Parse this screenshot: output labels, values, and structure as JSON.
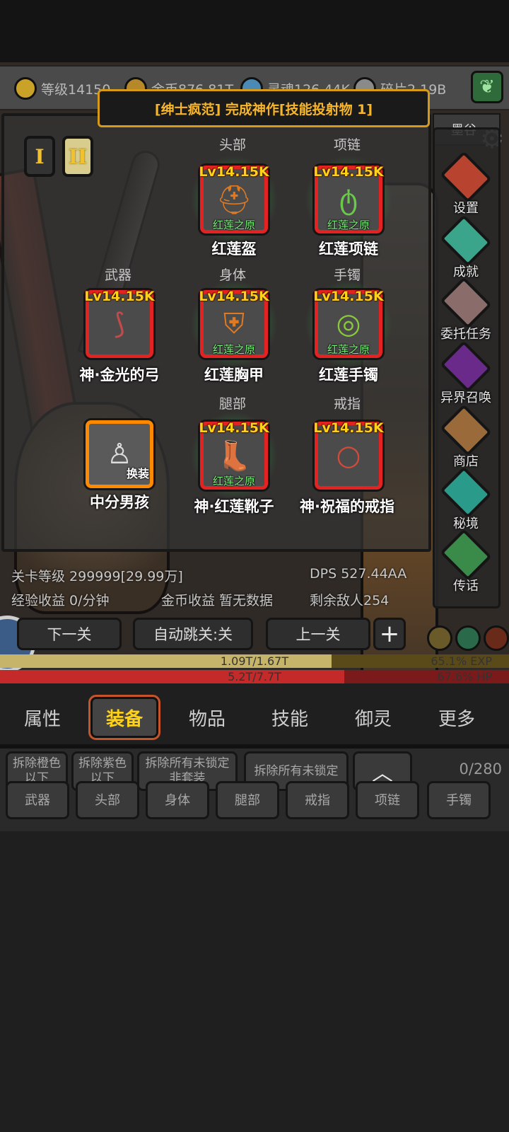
{
  "resources": {
    "level": "等级14150",
    "gold": "金币876.81T",
    "soul": "灵魂126.44K",
    "shard": "碎片2.19B"
  },
  "banner": "[绅士疯范] 完成神作[技能投射物 1]",
  "zone_title": "墨谷",
  "loadout_tabs": [
    "I",
    "II"
  ],
  "slots": {
    "head": {
      "label": "头部",
      "level": "Lv14.15K",
      "set": "红莲之原",
      "name": "红莲盔"
    },
    "necklace": {
      "label": "项链",
      "level": "Lv14.15K",
      "set": "红莲之原",
      "name": "红莲项链"
    },
    "weapon": {
      "label": "武器",
      "level": "Lv14.15K",
      "name": "神·金光的弓"
    },
    "body": {
      "label": "身体",
      "level": "Lv14.15K",
      "set": "红莲之原",
      "name": "红莲胸甲"
    },
    "bracelet": {
      "label": "手镯",
      "level": "Lv14.15K",
      "set": "红莲之原",
      "name": "红莲手镯"
    },
    "character": {
      "swap": "换装",
      "name": "中分男孩"
    },
    "legs": {
      "label": "腿部",
      "level": "Lv14.15K",
      "set": "红莲之原",
      "name": "神·红莲靴子"
    },
    "ring": {
      "label": "戒指",
      "level": "Lv14.15K",
      "name": "神·祝福的戒指"
    }
  },
  "side_menu": [
    {
      "label": "设置",
      "icon": "gear-diamond-icon",
      "color": "#b8432f"
    },
    {
      "label": "成就",
      "icon": "star-icon",
      "color": "#3aa58a"
    },
    {
      "label": "委托任务",
      "icon": "handshake-icon",
      "color": "#8a6d6a"
    },
    {
      "label": "异界召唤",
      "icon": "portal-icon",
      "color": "#6a2a8a"
    },
    {
      "label": "商店",
      "icon": "bag-icon",
      "color": "#9a6a3a"
    },
    {
      "label": "秘境",
      "icon": "swirl-icon",
      "color": "#2a9a8a"
    },
    {
      "label": "传话",
      "icon": "megaphone-icon",
      "color": "#3a8a4a"
    }
  ],
  "stats": {
    "stage": "关卡等级 299999[29.99万]",
    "dps": "DPS 527.44AA",
    "exp_rate": "经验收益 0/分钟",
    "gold_rate": "金币收益 暂无数据",
    "enemies": "剩余敌人254"
  },
  "nav": {
    "next": "下一关",
    "auto": "自动跳关:关",
    "prev": "上一关",
    "plus": "+"
  },
  "exp_bar": {
    "text": "1.09T/1.67T",
    "percent_text": "65.1% EXP",
    "fraction": 0.651
  },
  "hp_bar": {
    "text": "5.2T/7.7T",
    "percent_text": "67.6%  HP",
    "fraction": 0.676
  },
  "bottom_tabs": [
    "属性",
    "装备",
    "物品",
    "技能",
    "御灵",
    "更多"
  ],
  "active_tab": "装备",
  "actions": {
    "remove_orange": "拆除橙色\n以下",
    "remove_purple": "拆除紫色\n以下",
    "remove_unlocked_nonset": "拆除所有未锁定\n非套装",
    "remove_all_unlocked": "拆除所有未锁定",
    "count": "0/280"
  },
  "filters": [
    "武器",
    "头部",
    "身体",
    "腿部",
    "戒指",
    "项链",
    "手镯"
  ],
  "colors": {
    "accent_gold": "#ffd21a",
    "legend_red": "#e32222",
    "set_green": "#7cf07c",
    "exp_bar": "#c6b46a",
    "hp_bar": "#c42a2a"
  }
}
